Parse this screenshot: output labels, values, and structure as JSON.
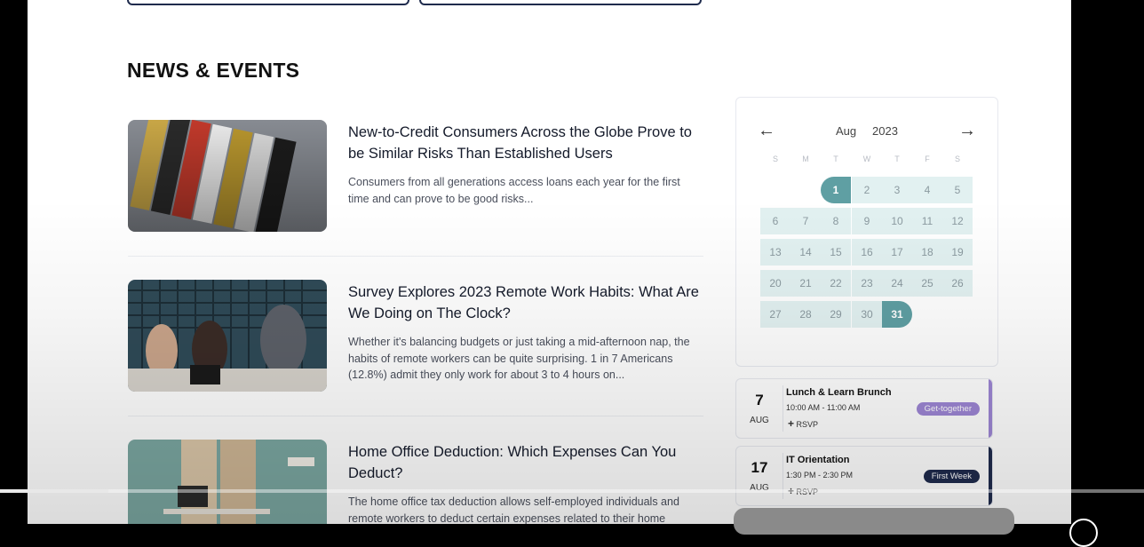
{
  "section": {
    "title": "NEWS & EVENTS"
  },
  "articles": [
    {
      "title": "New-to-Credit Consumers Across the Globe Prove to be Similar Risks Than Established Users",
      "excerpt": "Consumers from all generations access loans each year for the first time and can prove to be good risks..."
    },
    {
      "title": "Survey Explores 2023 Remote Work Habits: What Are We Doing on The Clock?",
      "excerpt": "Whether it's balancing budgets or just taking a mid-afternoon nap, the habits of remote workers can be quite surprising. 1 in 7 Americans (12.8%) admit they only work for about 3 to 4 hours on..."
    },
    {
      "title": "Home Office Deduction: Which Expenses Can You Deduct?",
      "excerpt": "The home office tax deduction allows self-employed individuals and remote workers to deduct certain expenses related to their home"
    }
  ],
  "calendar": {
    "prev_icon": "←",
    "next_icon": "→",
    "month": "Aug",
    "year": "2023",
    "weekdays": [
      "S",
      "M",
      "T",
      "W",
      "T",
      "F",
      "S"
    ],
    "days": [
      "1",
      "2",
      "3",
      "4",
      "5",
      "6",
      "7",
      "8",
      "9",
      "10",
      "11",
      "12",
      "13",
      "14",
      "15",
      "16",
      "17",
      "18",
      "19",
      "20",
      "21",
      "22",
      "23",
      "24",
      "25",
      "26",
      "27",
      "28",
      "29",
      "30",
      "31"
    ],
    "selected": [
      "1",
      "31"
    ]
  },
  "events": [
    {
      "day": "7",
      "month": "AUG",
      "title": "Lunch & Learn Brunch",
      "time": "10:00 AM - 11:00 AM",
      "rsvp": "RSVP",
      "tag": "Get-together",
      "tag_color": "#9d86d4",
      "bar_color": "#9d86d4"
    },
    {
      "day": "17",
      "month": "AUG",
      "title": "IT Orientation",
      "time": "1:30 PM - 2:30 PM",
      "rsvp": "RSVP",
      "tag": "First Week",
      "tag_color": "#1f2b4d",
      "bar_color": "#1f2b4d"
    }
  ],
  "video": {
    "progress": 0.095
  }
}
